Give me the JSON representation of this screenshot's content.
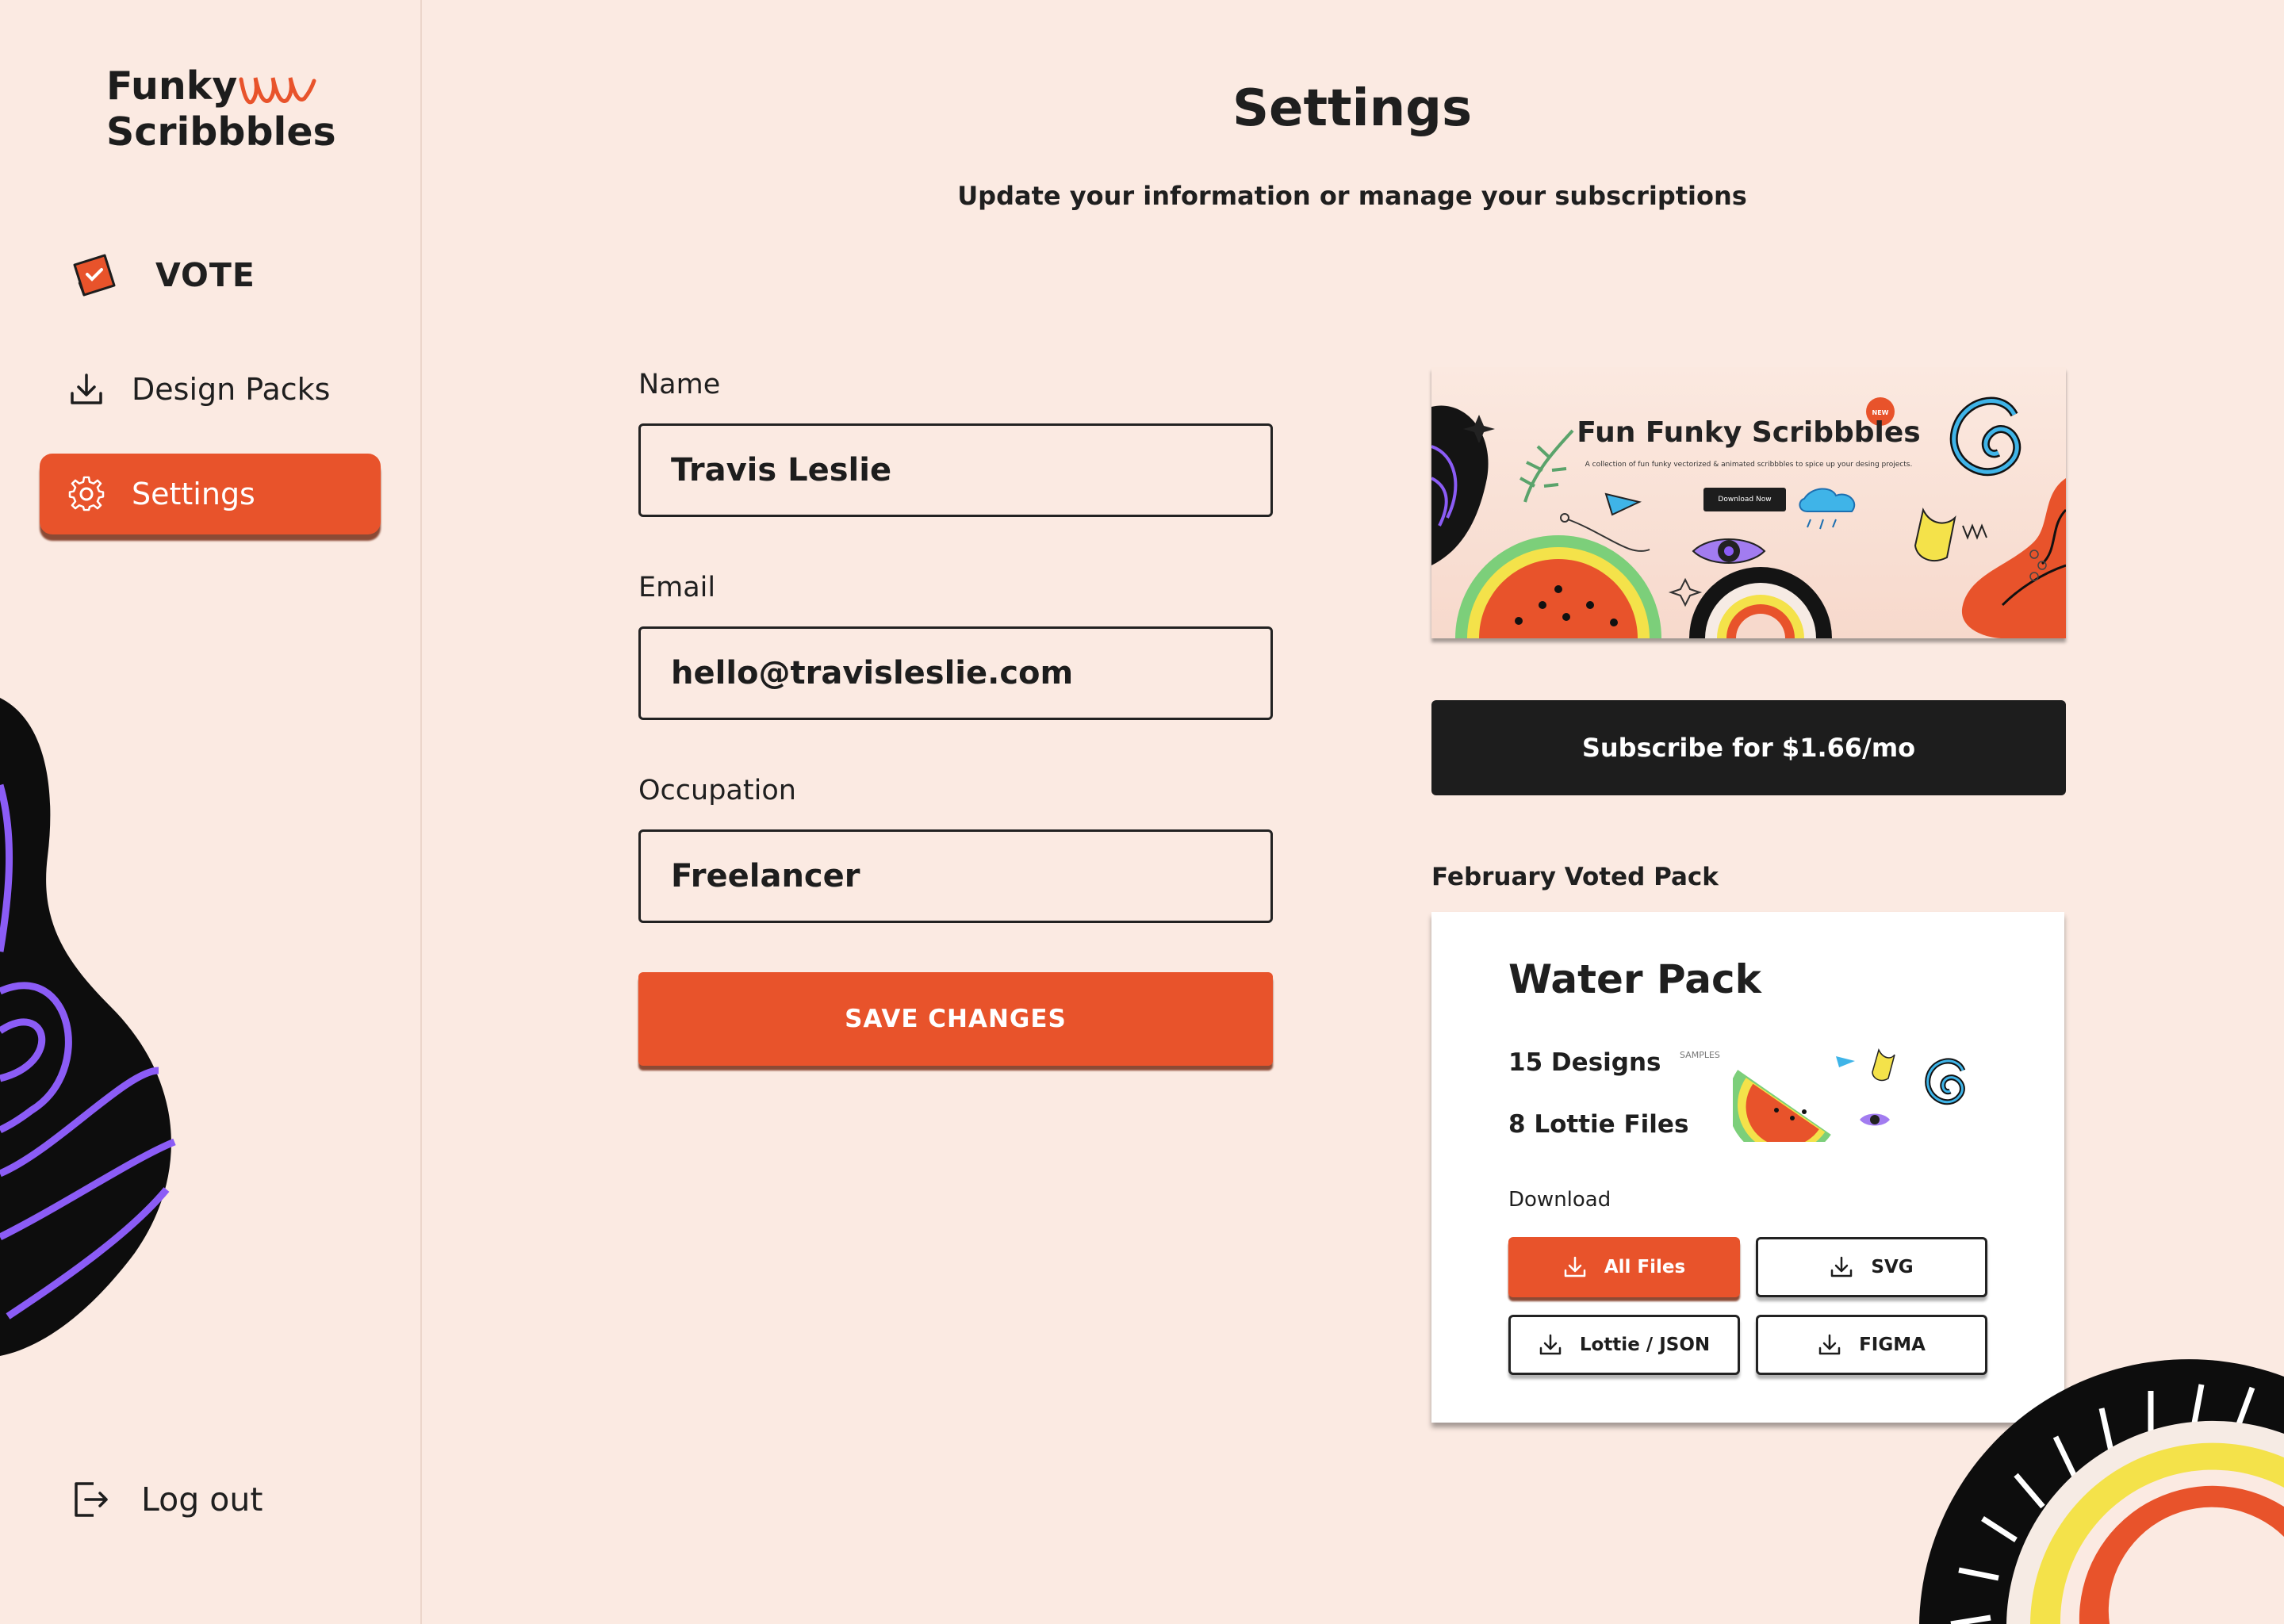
{
  "sidebar": {
    "logo_line1": "Funky",
    "logo_line2": "Scribbbles",
    "vote_label": "VOTE",
    "items": [
      {
        "label": "Design Packs",
        "icon": "download-icon"
      },
      {
        "label": "Settings",
        "icon": "gear-icon",
        "active": true
      }
    ],
    "logout_label": "Log out"
  },
  "header": {
    "title": "Settings",
    "subtitle": "Update your information or manage your subscriptions"
  },
  "form": {
    "name_label": "Name",
    "name_value": "Travis Leslie",
    "email_label": "Email",
    "email_value": "hello@travisleslie.com",
    "occupation_label": "Occupation",
    "occupation_value": "Freelancer",
    "save_label": "SAVE CHANGES"
  },
  "banner": {
    "title": "Fun Funky Scribbbles",
    "subtitle": "A collection of fun funky vectorized & animated scribbbles to spice up your desing projects.",
    "button_label": "Download Now",
    "badge": "NEW"
  },
  "subscribe_label": "Subscribe for $1.66/mo",
  "voted_pack": {
    "section_label": "February Voted Pack",
    "title": "Water Pack",
    "designs": "15 Designs",
    "lottie": "8 Lottie Files",
    "samples_label": "SAMPLES",
    "download_label": "Download",
    "buttons": [
      "All Files",
      "SVG",
      "Lottie / JSON",
      "FIGMA"
    ]
  },
  "colors": {
    "accent": "#E8532B",
    "background": "#FBEAE2",
    "dark": "#1D1D1D",
    "purple": "#8B5CF6"
  }
}
